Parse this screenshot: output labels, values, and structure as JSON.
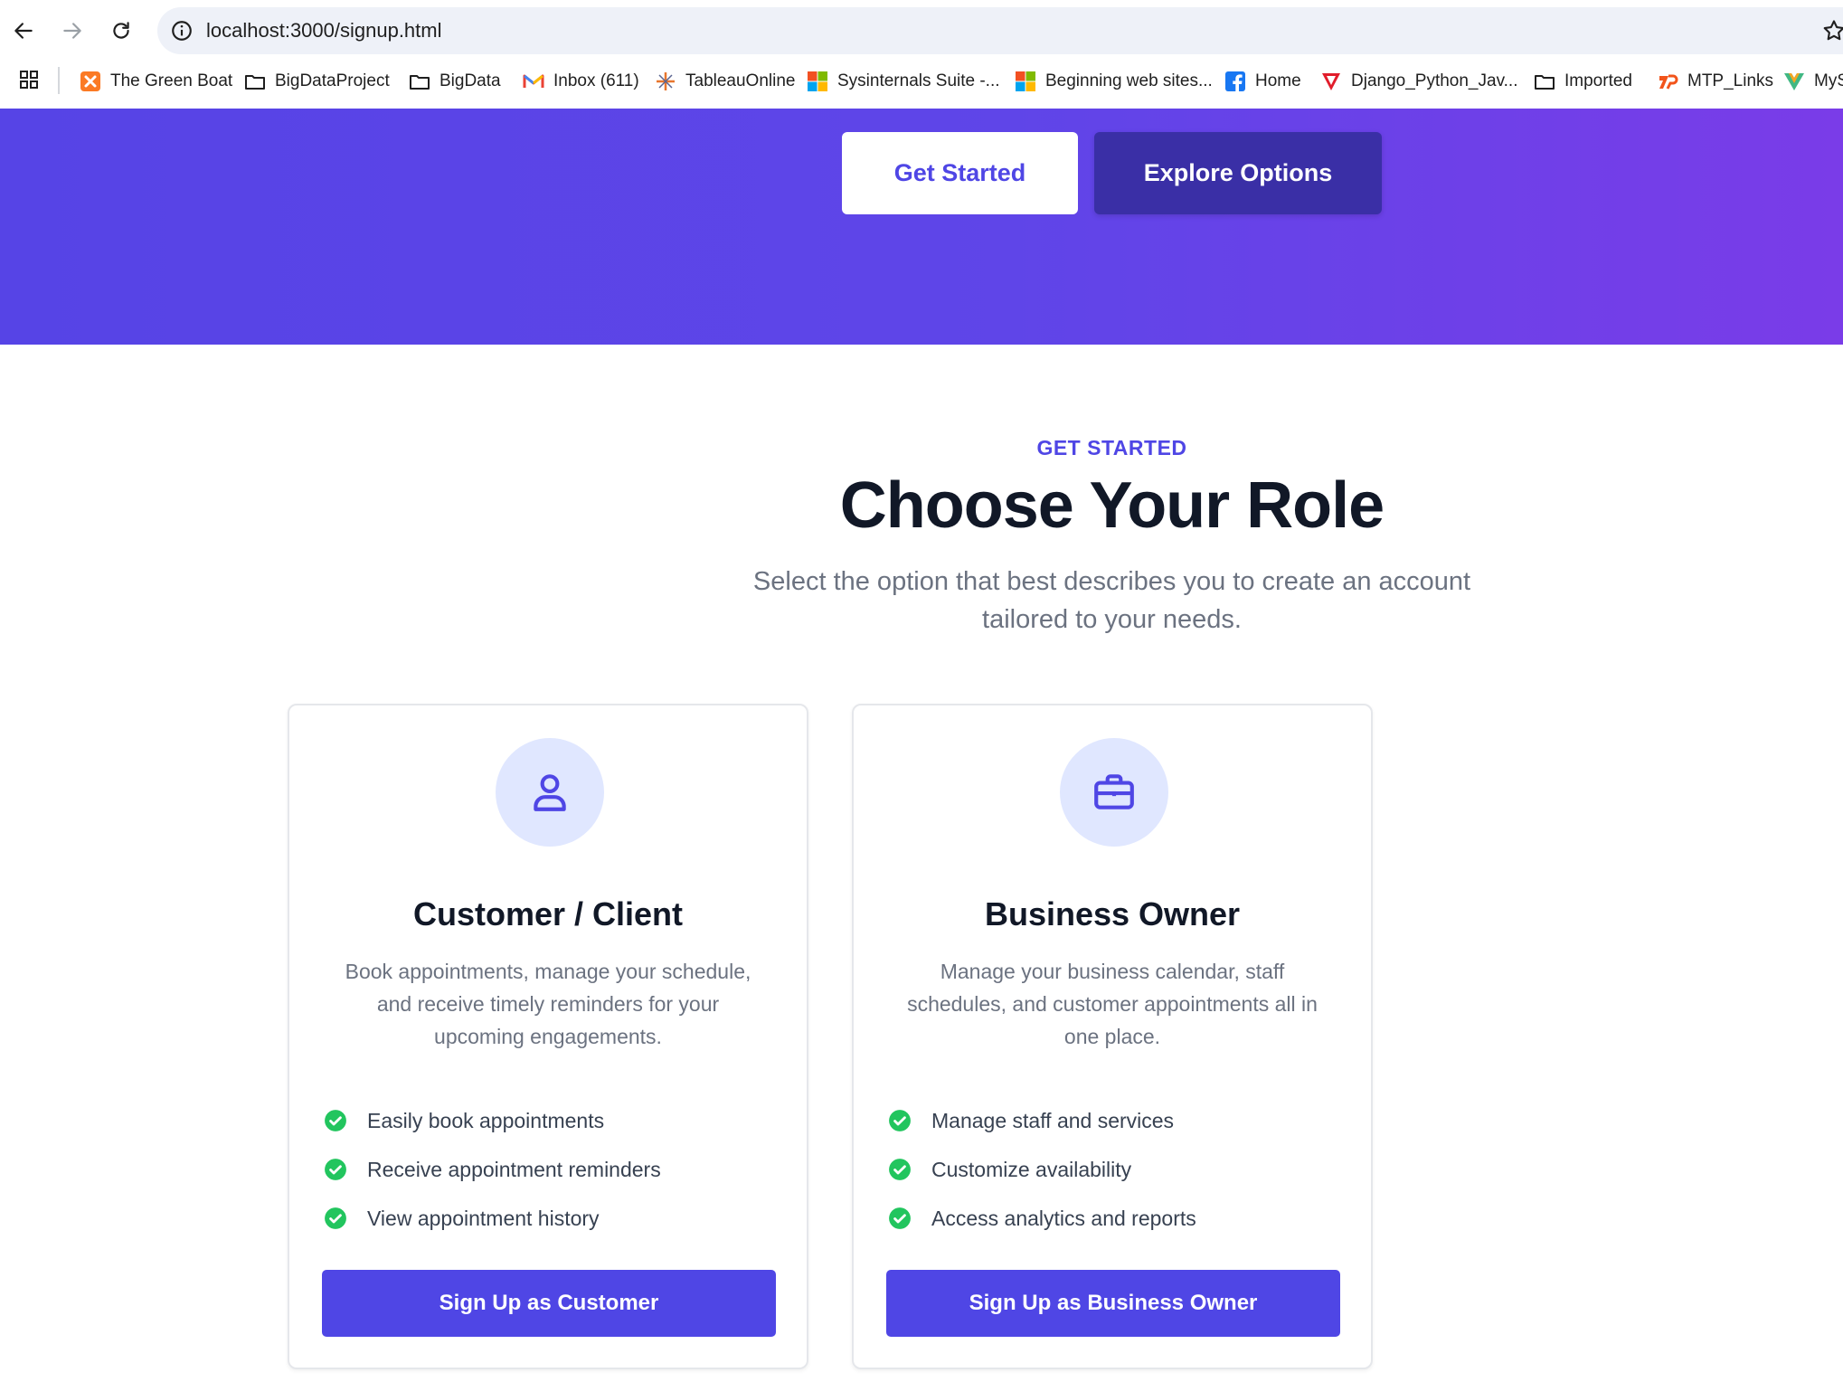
{
  "browser": {
    "url": "localhost:3000/signup.html",
    "bookmarks": [
      {
        "label": "The Green Boat",
        "icon": "xampp-icon"
      },
      {
        "label": "BigDataProject",
        "icon": "folder-icon"
      },
      {
        "label": "BigData",
        "icon": "folder-icon"
      },
      {
        "label": "Inbox (611)",
        "icon": "gmail-icon"
      },
      {
        "label": "TableauOnline",
        "icon": "tableau-icon"
      },
      {
        "label": "Sysinternals Suite -...",
        "icon": "microsoft-icon"
      },
      {
        "label": "Beginning web sites...",
        "icon": "microsoft-icon"
      },
      {
        "label": "Home",
        "icon": "facebook-icon"
      },
      {
        "label": "Django_Python_Jav...",
        "icon": "red-v-icon"
      },
      {
        "label": "Imported",
        "icon": "folder-icon"
      },
      {
        "label": "MTP_Links",
        "icon": "mtp-icon"
      },
      {
        "label": "MyS",
        "icon": "vue-icon"
      }
    ]
  },
  "hero": {
    "get_started_label": "Get Started",
    "explore_label": "Explore Options"
  },
  "section": {
    "eyebrow": "GET STARTED",
    "title": "Choose Your Role",
    "subtitle": "Select the option that best describes you to create an account tailored to your needs."
  },
  "cards": [
    {
      "icon": "user-icon",
      "title": "Customer / Client",
      "description": "Book appointments, manage your schedule, and receive timely reminders for your upcoming engagements.",
      "features": [
        "Easily book appointments",
        "Receive appointment reminders",
        "View appointment history"
      ],
      "button": "Sign Up as Customer"
    },
    {
      "icon": "briefcase-icon",
      "title": "Business Owner",
      "description": "Manage your business calendar, staff schedules, and customer appointments all in one place.",
      "features": [
        "Manage staff and services",
        "Customize availability",
        "Access analytics and reports"
      ],
      "button": "Sign Up as Business Owner"
    }
  ],
  "colors": {
    "brand": "#4f46e5",
    "hero_gradient_start": "#5644e6",
    "hero_gradient_end": "#7a3ce8",
    "check_green": "#22c55e",
    "icon_circle_bg": "#e0e7ff"
  }
}
